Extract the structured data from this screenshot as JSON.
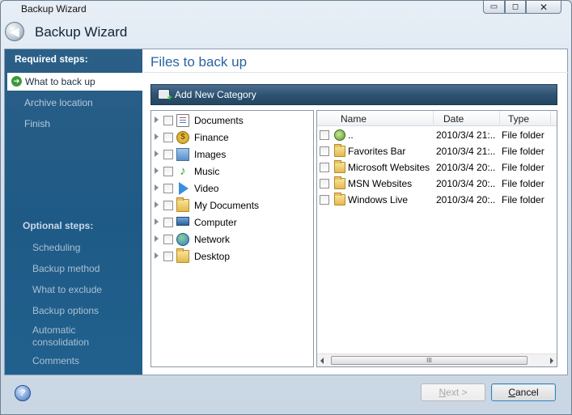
{
  "window": {
    "title": "Backup Wizard",
    "controls": {
      "minimize": "▭",
      "maximize": "◻",
      "close": "✕"
    }
  },
  "header": {
    "title": "Backup Wizard"
  },
  "sidebar": {
    "required_heading": "Required steps:",
    "required_steps": [
      {
        "label": "What to back up",
        "active": true
      },
      {
        "label": "Archive location"
      },
      {
        "label": "Finish"
      }
    ],
    "optional_heading": "Optional steps:",
    "optional_steps": [
      {
        "label": "Scheduling"
      },
      {
        "label": "Backup method"
      },
      {
        "label": "What to exclude"
      },
      {
        "label": "Backup options"
      },
      {
        "label": "Automatic consolidation"
      },
      {
        "label": "Comments"
      }
    ]
  },
  "main": {
    "title": "Files to back up",
    "toolbar": {
      "add_category_label": "Add New Category"
    },
    "tree": [
      {
        "label": "Documents",
        "icon": "document-icon"
      },
      {
        "label": "Finance",
        "icon": "finance-icon"
      },
      {
        "label": "Images",
        "icon": "images-icon"
      },
      {
        "label": "Music",
        "icon": "music-icon"
      },
      {
        "label": "Video",
        "icon": "video-icon"
      },
      {
        "label": "My Documents",
        "icon": "folder-icon"
      },
      {
        "label": "Computer",
        "icon": "computer-icon"
      },
      {
        "label": "Network",
        "icon": "network-icon"
      },
      {
        "label": "Desktop",
        "icon": "folder-icon"
      }
    ],
    "list": {
      "columns": [
        "Name",
        "Date",
        "Type"
      ],
      "rows": [
        {
          "name": "..",
          "date": "2010/3/4 21:...",
          "type": "File folder",
          "icon": "parent-folder-icon"
        },
        {
          "name": "Favorites Bar",
          "date": "2010/3/4 21:...",
          "type": "File folder",
          "icon": "folder-icon"
        },
        {
          "name": "Microsoft Websites",
          "date": "2010/3/4 20:...",
          "type": "File folder",
          "icon": "folder-icon"
        },
        {
          "name": "MSN Websites",
          "date": "2010/3/4 20:...",
          "type": "File folder",
          "icon": "folder-icon"
        },
        {
          "name": "Windows Live",
          "date": "2010/3/4 20:...",
          "type": "File folder",
          "icon": "folder-icon"
        }
      ],
      "scroll_grip": "III"
    }
  },
  "footer": {
    "help": "?",
    "next_prefix": "N",
    "next_rest": "ext >",
    "cancel_prefix": "C",
    "cancel_rest": "ancel"
  }
}
